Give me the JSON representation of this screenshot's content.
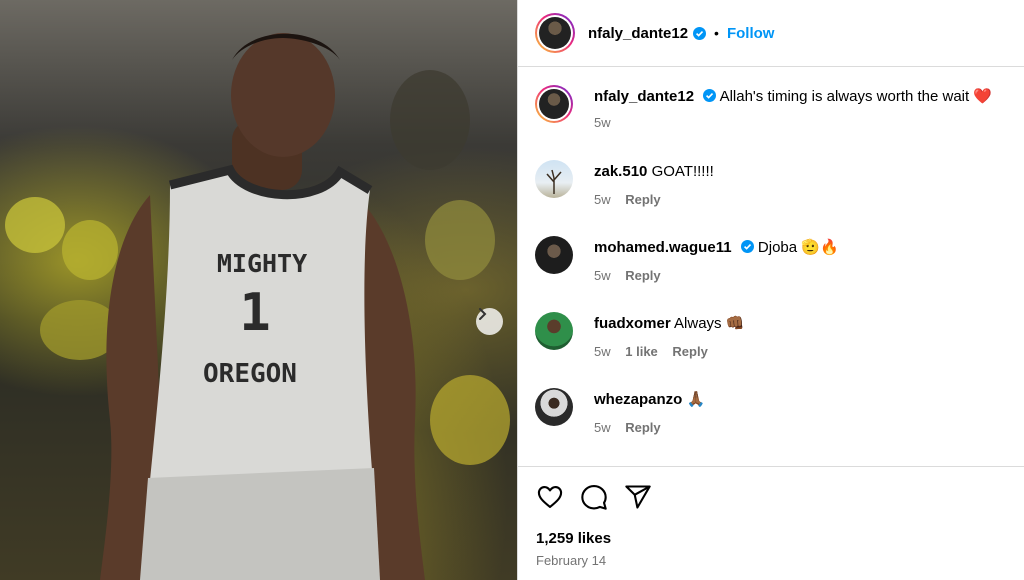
{
  "post": {
    "author": "nfaly_dante12",
    "follow_label": "Follow",
    "separator": "•",
    "caption": "Allah's timing is always worth the wait",
    "caption_emoji": "❤️",
    "caption_time": "5w",
    "likes": "1,259 likes",
    "date": "February 14",
    "photo": {
      "jersey_top": "MIGHTY",
      "jersey_number": "1",
      "jersey_bottom": "OREGON"
    }
  },
  "comments": [
    {
      "user": "zak.510",
      "text": "GOAT!!!!!",
      "emoji": "",
      "verified": false,
      "time": "5w",
      "likes": "",
      "reply": "Reply"
    },
    {
      "user": "mohamed.wague11",
      "text": "Djoba",
      "emoji": "🫡🔥",
      "verified": true,
      "time": "5w",
      "likes": "",
      "reply": "Reply"
    },
    {
      "user": "fuadxomer",
      "text": "Always",
      "emoji": "👊🏾",
      "verified": false,
      "time": "5w",
      "likes": "1 like",
      "reply": "Reply"
    },
    {
      "user": "whezapanzo",
      "text": "",
      "emoji": "🙏🏾",
      "verified": false,
      "time": "5w",
      "likes": "",
      "reply": "Reply"
    }
  ],
  "icons": {
    "verified": "verified-badge-icon",
    "like": "heart-icon",
    "comment": "comment-bubble-icon",
    "share": "paper-plane-icon",
    "next": "chevron-right-icon"
  },
  "colors": {
    "accent": "#0095f6",
    "verified": "#0095f6",
    "muted": "#737373",
    "divider": "#dbdbdb"
  }
}
